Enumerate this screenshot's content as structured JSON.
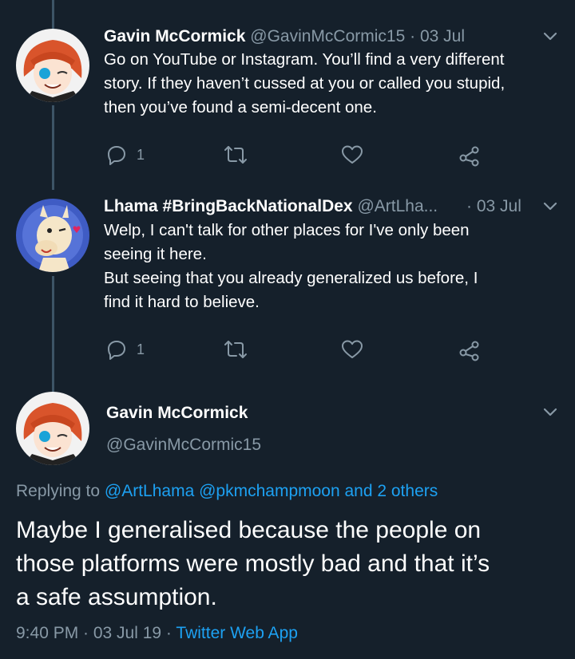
{
  "tweets": [
    {
      "name": "Gavin McCormick",
      "handle": "@GavinMcCormic15",
      "date": "· 03 Jul",
      "text_lines": [
        "Go on YouTube or Instagram. You’ll find a very different",
        "story. If they haven’t cussed at you or called you stupid,",
        "then you’ve found a semi-decent one."
      ],
      "reply_count": "1"
    },
    {
      "name": "Lhama #BringBackNationalDex",
      "handle": "@ArtLha...",
      "date": "· 03 Jul",
      "text_lines": [
        "Welp, I can't talk for other places for I've only been",
        "seeing it here.",
        "But seeing that you already generalized us before, I",
        "find it hard to believe."
      ],
      "reply_count": "1"
    }
  ],
  "main_tweet": {
    "name": "Gavin McCormick",
    "handle": "@GavinMcCormic15",
    "replying_prefix": "Replying to",
    "replying_to": "@ArtLhama @pkmchampmoon and 2 others",
    "text_lines": [
      "Maybe I generalised because the people on",
      "those platforms were mostly bad and that it’s",
      "a safe assumption."
    ],
    "time": "9:40 PM · 03 Jul 19 ·",
    "source": "Twitter Web App"
  },
  "icons": [
    "reply-icon",
    "retweet-icon",
    "like-icon",
    "share-icon",
    "chevron-down-icon"
  ],
  "colors": {
    "background": "#15202b",
    "secondary": "#8899a6",
    "link": "#1da1f2"
  }
}
